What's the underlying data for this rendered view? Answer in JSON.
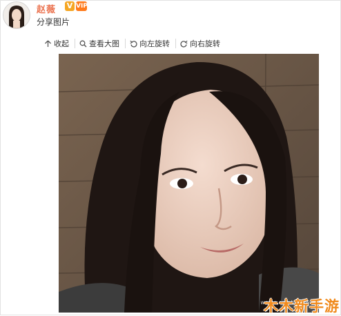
{
  "post": {
    "user_name": "赵薇",
    "verified_badge": "V",
    "vip_badge": "VIP",
    "text": "分享图片"
  },
  "toolbar": {
    "collapse_label": "收起",
    "view_large_label": "查看大图",
    "rotate_left_label": "向左旋转",
    "rotate_right_label": "向右旋转"
  },
  "photo": {
    "watermark_site": "weibo.com/zhaowei",
    "watermark_brand": "木木新手游"
  },
  "icons": {
    "collapse": "arrow-up-icon",
    "view_large": "magnifier-icon",
    "rotate_left": "rotate-left-icon",
    "rotate_right": "rotate-right-icon"
  },
  "colors": {
    "user_name": "#eb7350",
    "verified_badge": "#f5a623",
    "brand_watermark": "#f08a1c"
  }
}
